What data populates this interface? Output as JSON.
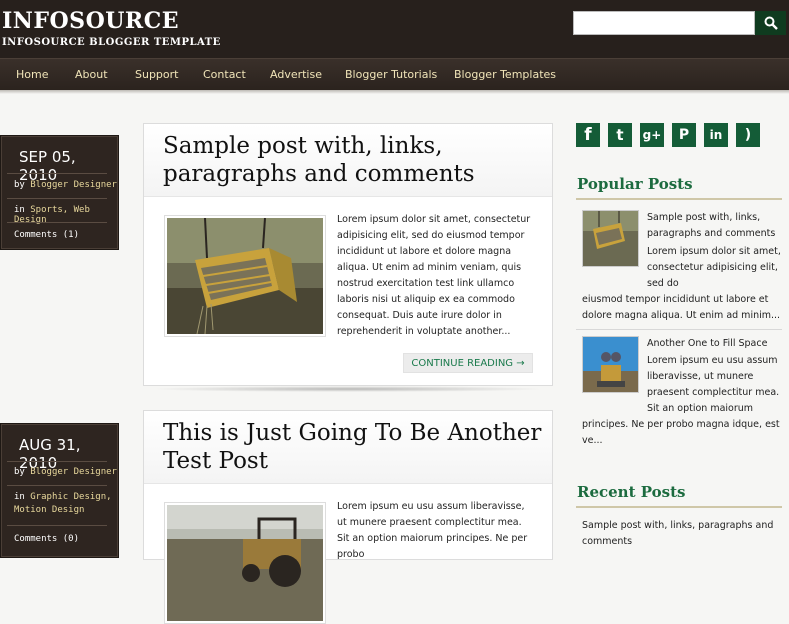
{
  "header": {
    "title": "INFOSOURCE",
    "description": "INFOSOURCE BLOGGER TEMPLATE",
    "search_placeholder": "",
    "search_icon": "search-icon"
  },
  "nav": {
    "items": [
      {
        "label": "Home"
      },
      {
        "label": "About"
      },
      {
        "label": "Support"
      },
      {
        "label": "Contact"
      },
      {
        "label": "Advertise"
      },
      {
        "label": "Blogger Tutorials"
      },
      {
        "label": "Blogger Templates"
      }
    ]
  },
  "posts": [
    {
      "date": "SEP 05, 2010",
      "by": "by",
      "author": "Blogger Designer",
      "in": "in",
      "categories": "Sports, Web Design",
      "comments": "Comments (1)",
      "title": "Sample post with, links, paragraphs and comments",
      "excerpt": "Lorem ipsum dolor sit amet, consectetur adipisicing elit, sed do eiusmod tempor incididunt ut labore et dolore magna aliqua. Ut enim ad minim veniam, quis nostrud exercitation test link ullamco laboris nisi ut aliquip ex ea commodo consequat. Duis aute irure dolor in reprehenderit in voluptate another...",
      "read_more": "CONTINUE READING →"
    },
    {
      "date": "AUG 31, 2010",
      "by": "by",
      "author": "Blogger Designer",
      "in": "in",
      "categories": "Graphic Design, Motion Design",
      "comments": "Comments (0)",
      "title": "This is Just Going To Be Another Test Post",
      "excerpt": "Lorem ipsum eu usu assum liberavisse, ut munere praesent complectitur mea. Sit an option maiorum principes. Ne per probo"
    }
  ],
  "sidebar": {
    "social": [
      {
        "icon": "facebook-icon",
        "glyph": "f"
      },
      {
        "icon": "twitter-icon",
        "glyph": "t"
      },
      {
        "icon": "google-plus-icon",
        "glyph": "g+"
      },
      {
        "icon": "pinterest-icon",
        "glyph": "P"
      },
      {
        "icon": "linkedin-icon",
        "glyph": "in"
      },
      {
        "icon": "rss-icon",
        "glyph": ")"
      }
    ],
    "popular_title": "Popular Posts",
    "popular": [
      {
        "title": "Sample post with, links, paragraphs and comments",
        "lead": "Lorem ipsum dolor sit amet, consectetur adipisicing elit, sed do",
        "rest": "eiusmod tempor incididunt ut labore et dolore magna aliqua. Ut enim ad minim..."
      },
      {
        "title": "Another One to Fill Space",
        "lead": "Lorem ipsum eu usu assum liberavisse, ut munere praesent complectitur mea. Sit an option maiorum",
        "rest": "principes. Ne per probo magna idque, est ve..."
      }
    ],
    "recent_title": "Recent Posts",
    "recent": [
      {
        "title": "Sample post with, links, paragraphs and comments"
      }
    ]
  }
}
